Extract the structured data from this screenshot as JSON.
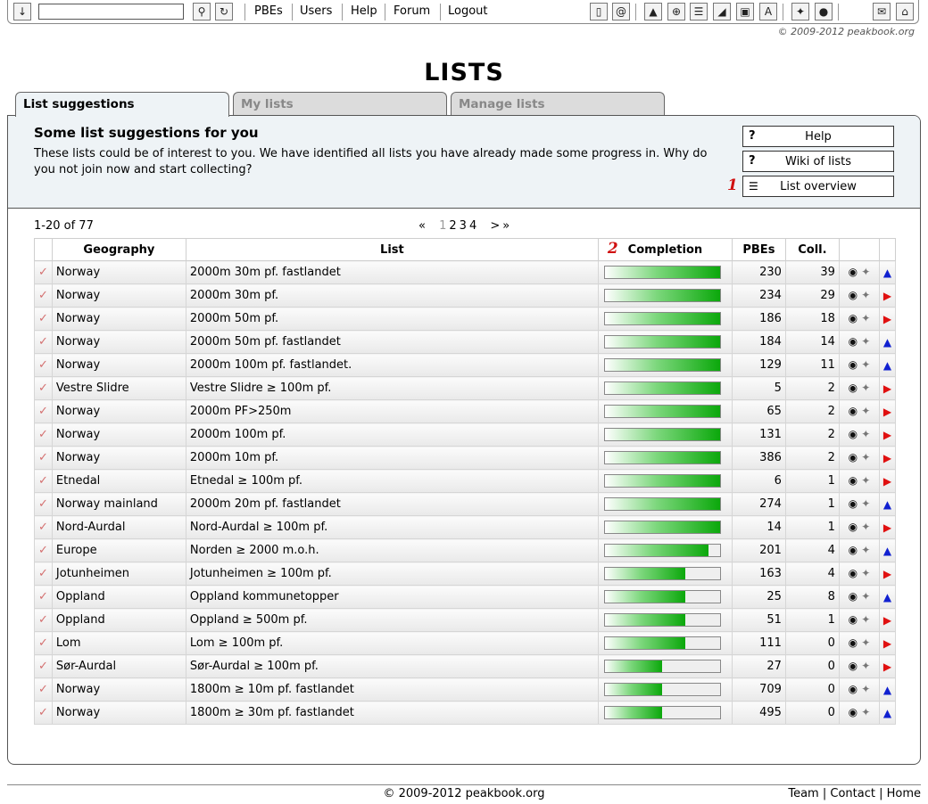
{
  "toolbar": {
    "search_value": "",
    "links": [
      "PBEs",
      "Users",
      "Help",
      "Forum",
      "Logout"
    ],
    "copyright": "© 2009-2012 peakbook.org"
  },
  "page": {
    "title": "LISTS"
  },
  "tabs": [
    {
      "label": "List suggestions",
      "active": true
    },
    {
      "label": "My lists",
      "active": false
    },
    {
      "label": "Manage lists",
      "active": false
    }
  ],
  "intro": {
    "title": "Some list suggestions for you",
    "text": "These lists could be of interest to you. We have identified all lists you have already made some progress in. Why do you not join now and start collecting?",
    "buttons": [
      {
        "symbol": "?",
        "label": "Help"
      },
      {
        "symbol": "?",
        "label": "Wiki of lists"
      },
      {
        "symbol": "",
        "label": "List overview"
      }
    ],
    "marker_1": "1",
    "marker_2": "2"
  },
  "pager": {
    "info": "1-20 of 77",
    "first": "«",
    "pages": [
      "1",
      "2",
      "3",
      "4"
    ],
    "next": ">",
    "last": "»"
  },
  "table": {
    "headers": [
      "Geography",
      "List",
      "Completion",
      "PBEs",
      "Coll."
    ],
    "rows": [
      {
        "geo": "Norway",
        "list": "2000m 30m pf. fastlandet",
        "completion": 1.0,
        "pbes": "230",
        "coll": "39",
        "dir": "up"
      },
      {
        "geo": "Norway",
        "list": "2000m 30m pf.",
        "completion": 1.0,
        "pbes": "234",
        "coll": "29",
        "dir": "right"
      },
      {
        "geo": "Norway",
        "list": "2000m 50m pf.",
        "completion": 1.0,
        "pbes": "186",
        "coll": "18",
        "dir": "right"
      },
      {
        "geo": "Norway",
        "list": "2000m 50m pf. fastlandet",
        "completion": 1.0,
        "pbes": "184",
        "coll": "14",
        "dir": "up"
      },
      {
        "geo": "Norway",
        "list": "2000m 100m pf. fastlandet.",
        "completion": 1.0,
        "pbes": "129",
        "coll": "11",
        "dir": "up"
      },
      {
        "geo": "Vestre Slidre",
        "list": "Vestre Slidre ≥ 100m pf.",
        "completion": 1.0,
        "pbes": "5",
        "coll": "2",
        "dir": "right"
      },
      {
        "geo": "Norway",
        "list": "2000m PF>250m",
        "completion": 1.0,
        "pbes": "65",
        "coll": "2",
        "dir": "right"
      },
      {
        "geo": "Norway",
        "list": "2000m 100m pf.",
        "completion": 1.0,
        "pbes": "131",
        "coll": "2",
        "dir": "right"
      },
      {
        "geo": "Norway",
        "list": "2000m 10m pf.",
        "completion": 1.0,
        "pbes": "386",
        "coll": "2",
        "dir": "right"
      },
      {
        "geo": "Etnedal",
        "list": "Etnedal ≥ 100m pf.",
        "completion": 1.0,
        "pbes": "6",
        "coll": "1",
        "dir": "right"
      },
      {
        "geo": "Norway mainland",
        "list": "2000m 20m pf. fastlandet",
        "completion": 1.0,
        "pbes": "274",
        "coll": "1",
        "dir": "up"
      },
      {
        "geo": "Nord-Aurdal",
        "list": "Nord-Aurdal ≥ 100m pf.",
        "completion": 1.0,
        "pbes": "14",
        "coll": "1",
        "dir": "right"
      },
      {
        "geo": "Europe",
        "list": "Norden ≥ 2000 m.o.h.",
        "completion": 0.9,
        "pbes": "201",
        "coll": "4",
        "dir": "up"
      },
      {
        "geo": "Jotunheimen",
        "list": "Jotunheimen ≥ 100m pf.",
        "completion": 0.7,
        "pbes": "163",
        "coll": "4",
        "dir": "right"
      },
      {
        "geo": "Oppland",
        "list": "Oppland kommunetopper",
        "completion": 0.7,
        "pbes": "25",
        "coll": "8",
        "dir": "up"
      },
      {
        "geo": "Oppland",
        "list": "Oppland ≥ 500m pf.",
        "completion": 0.7,
        "pbes": "51",
        "coll": "1",
        "dir": "right"
      },
      {
        "geo": "Lom",
        "list": "Lom ≥ 100m pf.",
        "completion": 0.7,
        "pbes": "111",
        "coll": "0",
        "dir": "right"
      },
      {
        "geo": "Sør-Aurdal",
        "list": "Sør-Aurdal ≥ 100m pf.",
        "completion": 0.5,
        "pbes": "27",
        "coll": "0",
        "dir": "right"
      },
      {
        "geo": "Norway",
        "list": "1800m ≥ 10m pf. fastlandet",
        "completion": 0.5,
        "pbes": "709",
        "coll": "0",
        "dir": "up"
      },
      {
        "geo": "Norway",
        "list": "1800m ≥ 30m pf. fastlandet",
        "completion": 0.5,
        "pbes": "495",
        "coll": "0",
        "dir": "up"
      }
    ]
  },
  "footer": {
    "copyright": "© 2009-2012 peakbook.org",
    "links": [
      "Team",
      "Contact",
      "Home"
    ]
  },
  "colors": {
    "check": "#d47070",
    "arrow_up": "#1020d0",
    "arrow_right": "#e01010",
    "progress": "#0ba80b",
    "marker": "#d01010"
  }
}
